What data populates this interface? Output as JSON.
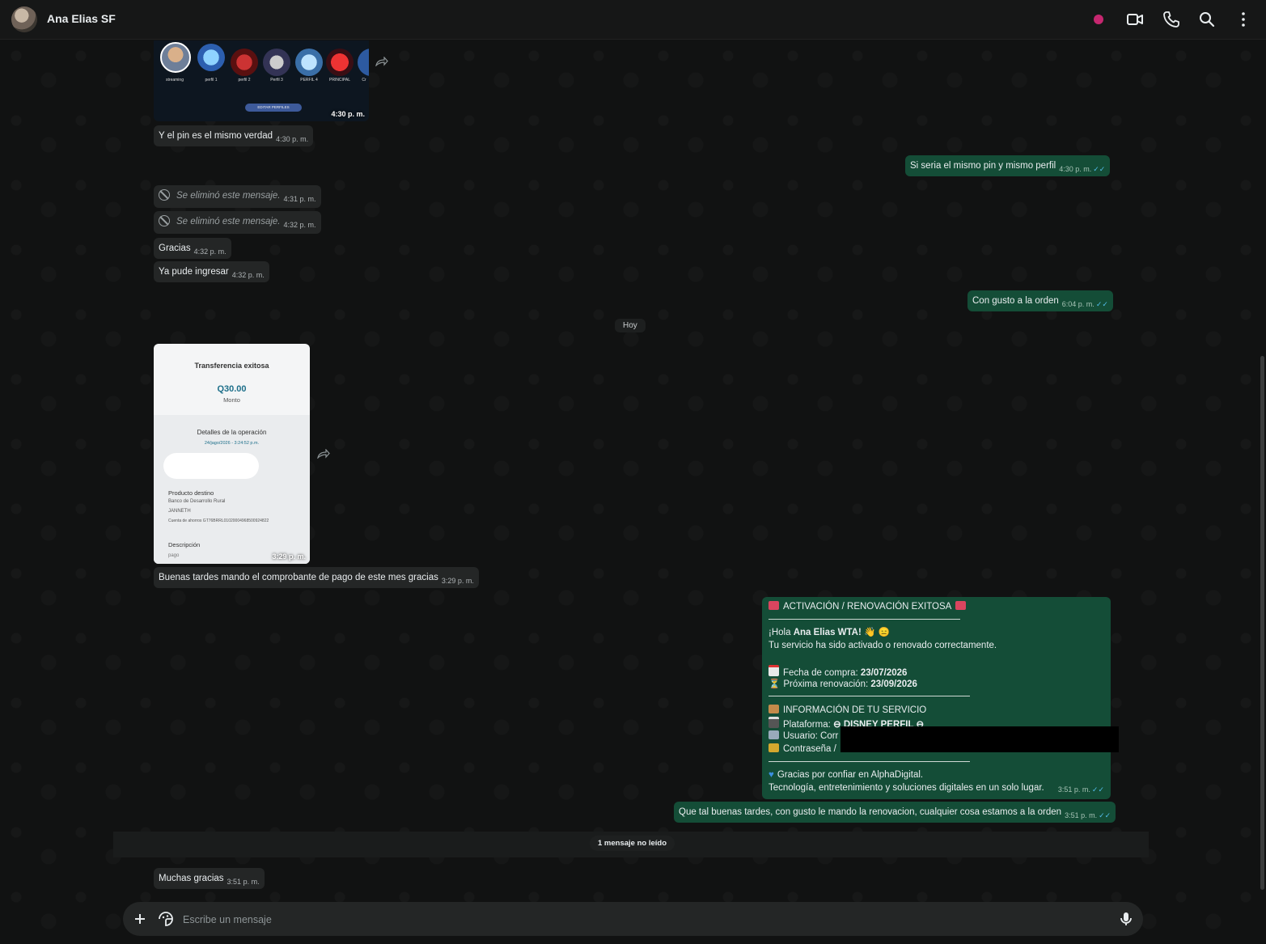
{
  "header": {
    "contact_name": "Ana Elias SF",
    "icons": [
      "status-dot-icon",
      "video-call-icon",
      "voice-call-icon",
      "search-icon",
      "menu-icon"
    ]
  },
  "profiles_image": {
    "labels": [
      "streaming",
      "perfil 1",
      "perfil 2",
      "Perfil 3",
      "PERFIL 4",
      "PRINCIPAL",
      "Cr"
    ],
    "button": "EDITAR PERFILES",
    "time": "4:30 p. m."
  },
  "messages": [
    {
      "text": "Y el pin es el mismo verdad",
      "time": "4:30 p. m."
    },
    {
      "text": "Si seria el mismo pin y mismo perfil",
      "time": "4:30 p. m."
    },
    {
      "text": "Se eliminó este mensaje.",
      "time": "4:31 p. m."
    },
    {
      "text": "Se eliminó este mensaje.",
      "time": "4:32 p. m."
    },
    {
      "text": "Gracias",
      "time": "4:32 p. m."
    },
    {
      "text": "Ya pude ingresar",
      "time": "4:32 p. m."
    },
    {
      "text": "Con gusto a la orden",
      "time": "6:04 p. m."
    },
    {
      "text": "Buenas tardes mando el comprobante de pago de este mes gracias",
      "time": "3:29 p. m."
    },
    {
      "text": "Que tal buenas tardes, con gusto le mando la renovacion, cualquier cosa estamos a la orden",
      "time": "3:51 p. m."
    },
    {
      "text": "Muchas gracias",
      "time": "3:51 p. m."
    }
  ],
  "date_divider": "Hoy",
  "receipt": {
    "title": "Transferencia exitosa",
    "amount": "Q30.00",
    "amount_label": "Monto",
    "details_title": "Detalles de la operación",
    "date": "24/jago/2026 - 3:24:52 p.m.",
    "product_label": "Producto destino",
    "bank": "Banco de Desarrollo Rural",
    "holder": "JANNETH",
    "account": "Cuenta de ahorros GT76BRRL01020004968500924822",
    "desc_label": "Descripción",
    "desc_value": "pago",
    "time": "3:29 p. m."
  },
  "activation": {
    "heading": "ACTIVACIÓN / RENOVACIÓN EXITOSA",
    "greeting_prefix": "¡Hola ",
    "greeting_name": "Ana Elias WTA!",
    "line_activated": "Tu servicio ha sido activado o renovado correctamente.",
    "purchase_label": "Fecha de compra: ",
    "purchase_date": "23/07/2026",
    "renewal_label": "Próxima renovación: ",
    "renewal_date": "23/09/2026",
    "info_title": "INFORMACIÓN DE TU SERVICIO",
    "platform_label": "Plataforma: ",
    "platform_value": "⊖ DISNEY PERFIL ⊖",
    "user_label": "Usuario: Corr",
    "password_label": "Contraseña / ",
    "thanks": "Gracias por confiar en AlphaDigital.",
    "tagline": "Tecnología, entretenimiento y soluciones digitales en un solo lugar.",
    "time": "3:51 p. m."
  },
  "unread_label": "1 mensaje no leído",
  "composer": {
    "placeholder": "Escribe un mensaje"
  },
  "colors": {
    "incoming_bubble": "#242626",
    "outgoing_bubble": "#144d37",
    "read_ticks": "#53bdeb",
    "background": "#111212"
  }
}
